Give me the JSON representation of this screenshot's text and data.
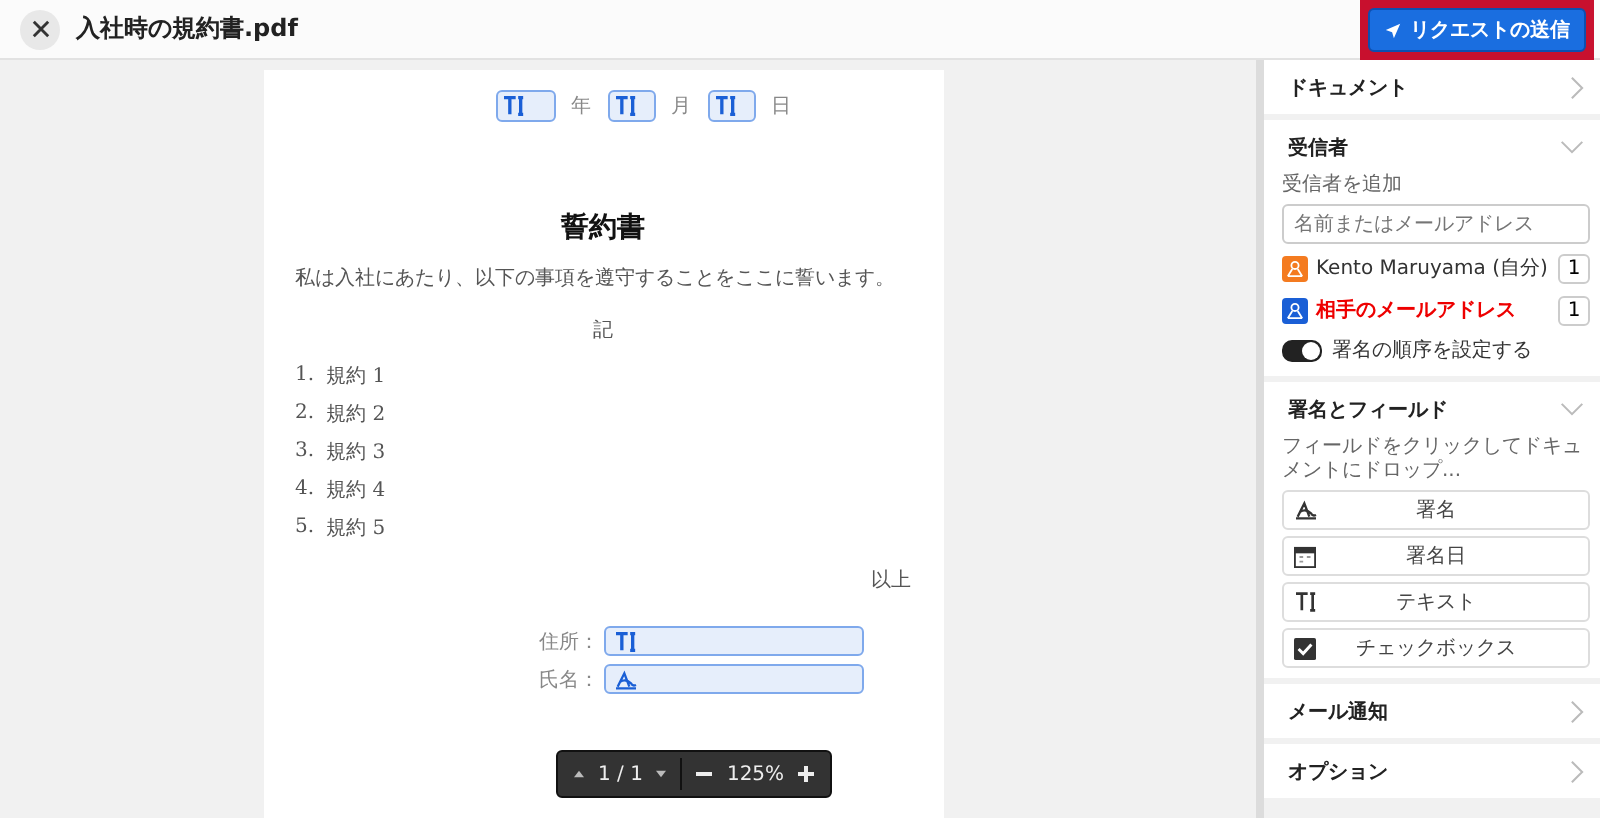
{
  "header": {
    "title": "入社時の規約書.pdf",
    "send_button": {
      "label": "リクエストの送信",
      "highlighted": true
    }
  },
  "document": {
    "date_fields": [
      {
        "suffix": "年",
        "wide": true
      },
      {
        "suffix": "月",
        "wide": false
      },
      {
        "suffix": "日",
        "wide": false
      }
    ],
    "title": "誓約書",
    "intro": "私は入社にあたり、以下の事項を遵守することをここに誓います。",
    "note_heading": "記",
    "items": [
      {
        "number": "1.",
        "text": "規約 1"
      },
      {
        "number": "2.",
        "text": "規約 2"
      },
      {
        "number": "3.",
        "text": "規約 3"
      },
      {
        "number": "4.",
        "text": "規約 4"
      },
      {
        "number": "5.",
        "text": "規約 5"
      }
    ],
    "closing": "以上",
    "signature_fields": [
      {
        "label": "住所：",
        "kind": "text"
      },
      {
        "label": "氏名：",
        "kind": "signature"
      }
    ]
  },
  "pager": {
    "page": "1 / 1",
    "zoom": "125%"
  },
  "panel": {
    "sections": [
      {
        "title": "ドキュメント",
        "expanded": false
      },
      {
        "kind": "recipients",
        "title": "受信者",
        "expanded": true,
        "add_label": "受信者を追加",
        "placeholder": "名前またはメールアドレス",
        "people": [
          {
            "name": "Kento Maruyama (自分)",
            "order": "1",
            "color": "#f47b20",
            "error": false
          },
          {
            "name": "相手のメールアドレス",
            "order": "1",
            "color": "#1a5fd6",
            "error": true
          }
        ],
        "order_toggle": {
          "label": "署名の順序を設定する",
          "on": true
        }
      },
      {
        "kind": "fields",
        "title": "署名とフィールド",
        "expanded": true,
        "hint": "フィールドをクリックしてドキュメントにドロップ...",
        "fields": [
          {
            "kind": "signature",
            "label": "署名"
          },
          {
            "kind": "date",
            "label": "署名日"
          },
          {
            "kind": "text",
            "label": "テキスト"
          },
          {
            "kind": "checkbox",
            "label": "チェックボックス"
          }
        ]
      },
      {
        "title": "メール通知",
        "expanded": false
      },
      {
        "title": "オプション",
        "expanded": false
      }
    ]
  }
}
